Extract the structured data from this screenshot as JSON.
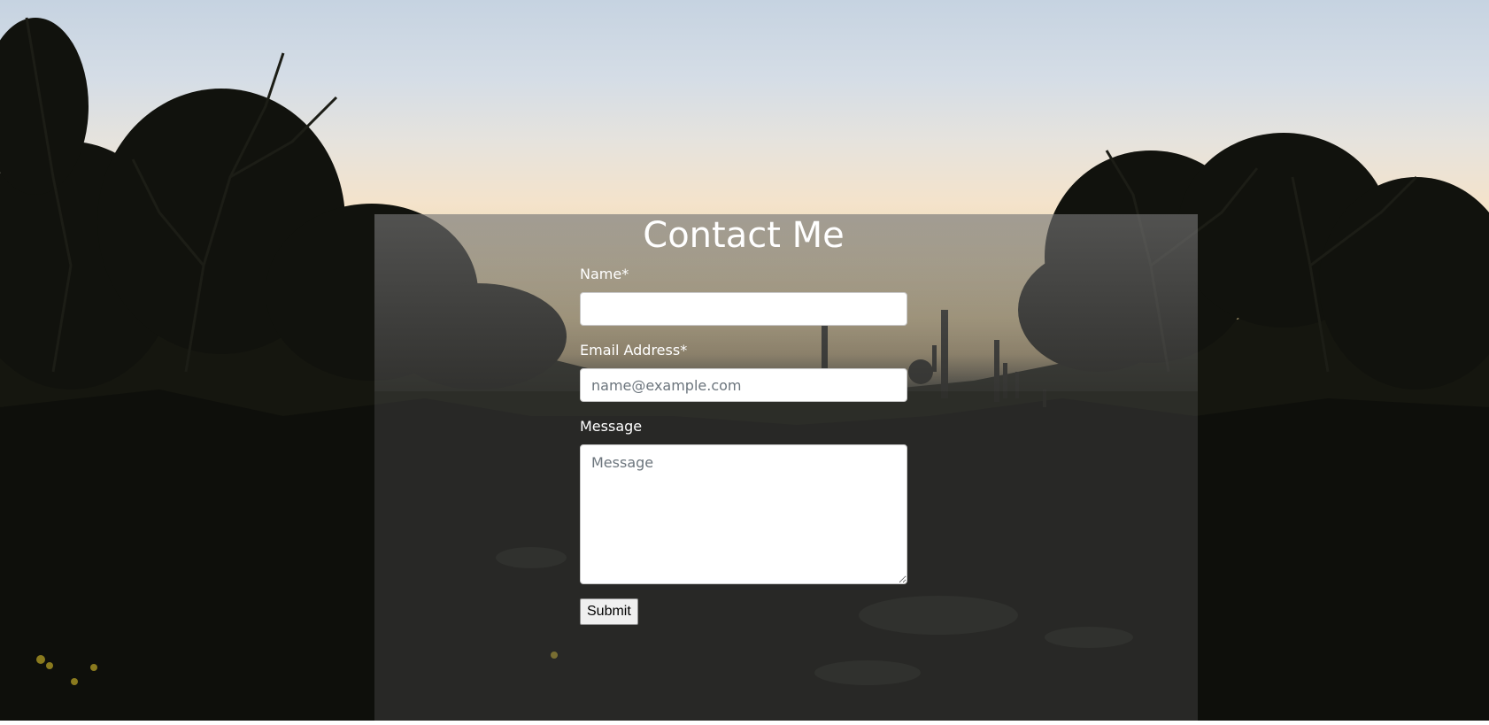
{
  "page": {
    "title": "Contact Me"
  },
  "form": {
    "name": {
      "label": "Name*",
      "value": "",
      "placeholder": ""
    },
    "email": {
      "label": "Email Address*",
      "value": "",
      "placeholder": "name@example.com"
    },
    "message": {
      "label": "Message",
      "value": "",
      "placeholder": "Message"
    },
    "submit_label": "Submit"
  },
  "colors": {
    "text": "#ffffff",
    "overlay": "#5a5a5a",
    "input_background": "#ffffff"
  }
}
